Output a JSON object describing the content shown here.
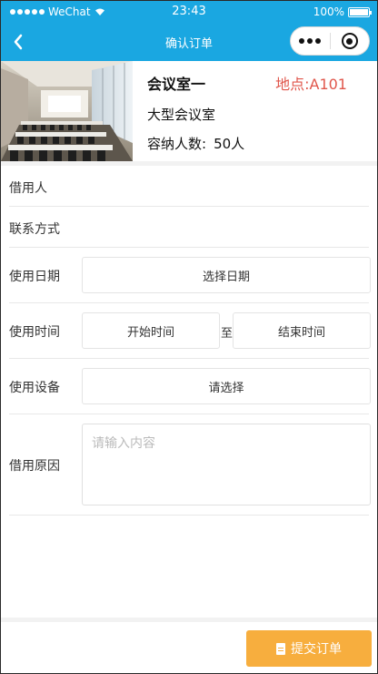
{
  "status_bar": {
    "carrier": "WeChat",
    "time": "23:43",
    "battery": "100%"
  },
  "nav": {
    "title": "确认订单"
  },
  "room": {
    "name": "会议室一",
    "location": "地点:A101",
    "type": "大型会议室",
    "capacity_label": "容纳人数:",
    "capacity_value": "50人"
  },
  "form": {
    "borrower_label": "借用人",
    "contact_label": "联系方式",
    "date_label": "使用日期",
    "date_placeholder": "选择日期",
    "time_label": "使用时间",
    "start_time_placeholder": "开始时间",
    "to_label": "至",
    "end_time_placeholder": "结束时间",
    "device_label": "使用设备",
    "device_placeholder": "请选择",
    "reason_label": "借用原因",
    "reason_placeholder": "请输入内容"
  },
  "submit": {
    "label": "提交订单"
  },
  "colors": {
    "header": "#1aa7e1",
    "location": "#e0564b",
    "submit": "#f7ae3e"
  }
}
